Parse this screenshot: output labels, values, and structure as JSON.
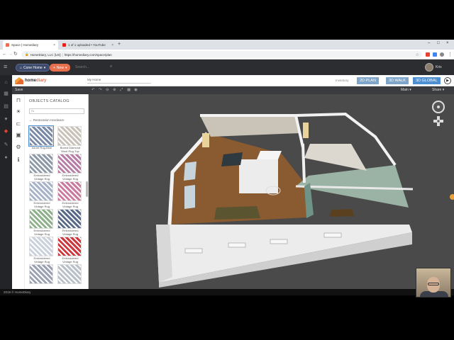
{
  "browser": {
    "tabs": [
      {
        "title": "Space | Homediary",
        "fav_color": "#e9704f",
        "active": true
      },
      {
        "title": "1 of 1 uploaded • YouTube",
        "fav_color": "#e62117",
        "active": false
      }
    ],
    "new_tab_symbol": "+",
    "window_controls": [
      "–",
      "□",
      "×"
    ],
    "url_prefix": "HomeDiary, LLC [US]",
    "url": "https://homediary.com/space/plan",
    "back_symbol": "←",
    "forward_symbol": "→",
    "reload_symbol": "↻"
  },
  "header": {
    "home_select": "Cone Home",
    "new_button": "New",
    "search_placeholder": "Search...",
    "user_name": "Kris"
  },
  "editor": {
    "logo_text_a": "home",
    "logo_text_b": "diary",
    "project_name": "My Home",
    "inventory_label": "Inventory",
    "views": [
      "2D PLAN",
      "3D WALK",
      "3D GLOBAL"
    ],
    "active_view": "3D GLOBAL",
    "save_label": "Save",
    "level_dropdown": "Main ▾",
    "share_dropdown": "Share ▾"
  },
  "catalog": {
    "title": "OBJECTS CATALOG",
    "search_value": "ru",
    "breadcrumb": "Restoration Hardware",
    "items": [
      {
        "label": "Azure Rug-Blue",
        "color": "#7b8aa8"
      },
      {
        "label": "Boxed Diamond Wool Rug-Tup",
        "color": "#c8c2b8"
      },
      {
        "label": "Embroidered Vintage Rug",
        "color": "#8f9aa9"
      },
      {
        "label": "Embroidered Vintage Rug",
        "color": "#b77fa8"
      },
      {
        "label": "Embroidered Vintage Rug",
        "color": "#a7b3c9"
      },
      {
        "label": "Embroidered Vintage Rug",
        "color": "#c97ba0"
      },
      {
        "label": "Embroidered Vintage Rug",
        "color": "#8fb28c"
      },
      {
        "label": "Embroidered Vintage Rug",
        "color": "#5a6b8a"
      },
      {
        "label": "Embroidered Vintage Rug",
        "color": "#c9d2dc"
      },
      {
        "label": "Embroidered Vintage Rug",
        "color": "#cc3a3f"
      },
      {
        "label": "",
        "color": "#9aa1b2"
      },
      {
        "label": "",
        "color": "#b9c0c7"
      }
    ]
  },
  "footer": {
    "copyright": "2019 © HomeDiary"
  }
}
